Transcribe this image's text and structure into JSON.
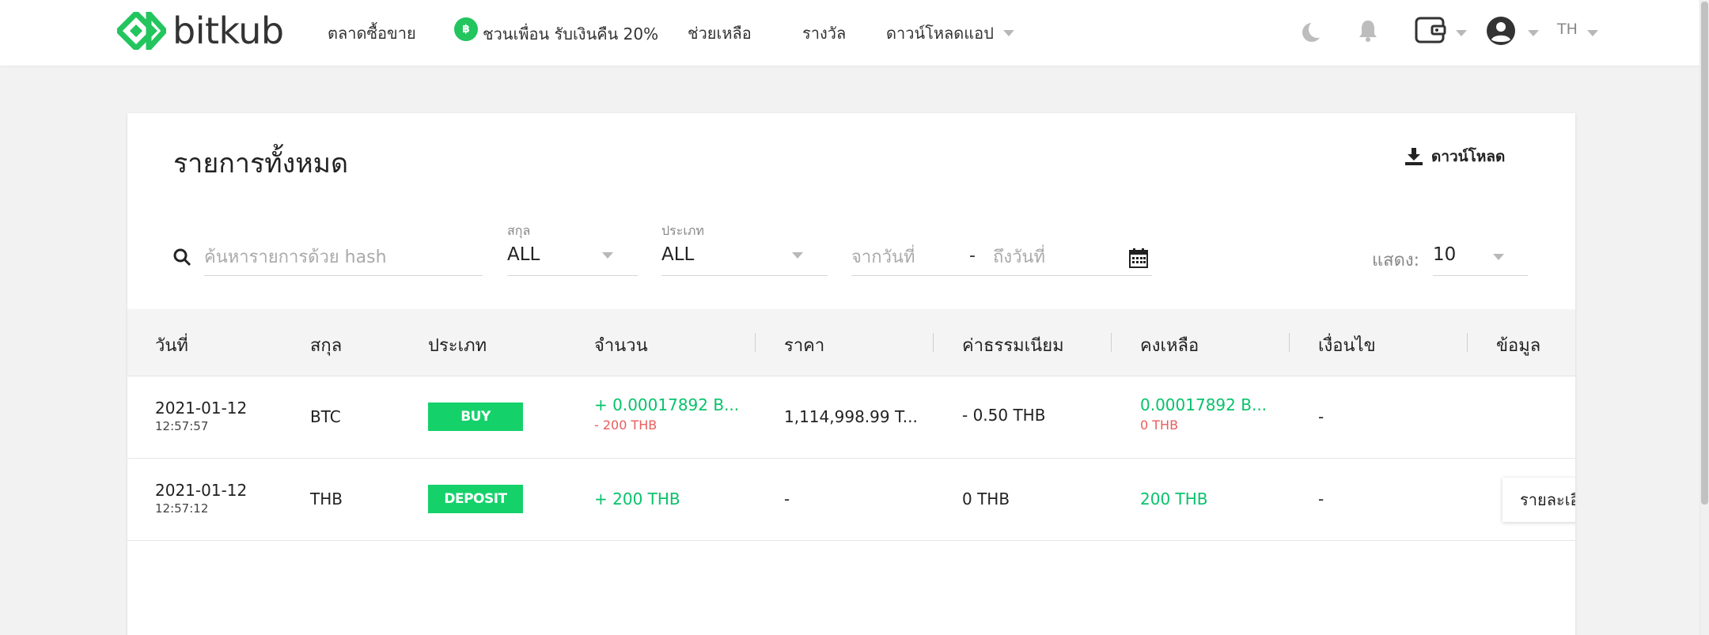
{
  "header": {
    "logo_text": "bitkub",
    "nav": {
      "market": "ตลาดซื้อขาย",
      "coin_glyph": "฿",
      "referral": "ชวนเพื่อน รับเงินคืน 20%",
      "help": "ช่วยเหลือ",
      "rewards": "รางวัล",
      "download_app": "ดาวน์โหลดแอป"
    },
    "icons": [
      "moon-icon",
      "bell-icon",
      "wallet-icon",
      "account-icon"
    ],
    "language": "TH"
  },
  "page": {
    "title": "รายการทั้งหมด",
    "download_label": "ดาวน์โหลด"
  },
  "filters": {
    "search_placeholder": "ค้นหารายการด้วย hash",
    "currency_label": "สกุล",
    "currency_value": "ALL",
    "type_label": "ประเภท",
    "type_value": "ALL",
    "from_placeholder": "จากวันที่",
    "date_separator": "-",
    "to_placeholder": "ถึงวันที่",
    "show_label": "แสดง:",
    "show_value": "10"
  },
  "table": {
    "columns": [
      "วันที่",
      "สกุล",
      "ประเภท",
      "จำนวน",
      "ราคา",
      "ค่าธรรมเนียม",
      "คงเหลือ",
      "เงื่อนไข",
      "ข้อมูล"
    ],
    "rows": [
      {
        "date": "2021-01-12",
        "time": "12:57:57",
        "currency": "BTC",
        "type": "BUY",
        "amount": "+ 0.00017892 B...",
        "amount_sub": "- 200 THB",
        "price": "1,114,998.99 T...",
        "fee": "- 0.50 THB",
        "balance": "0.00017892 B...",
        "balance_sub": "0 THB",
        "condition": "-"
      },
      {
        "date": "2021-01-12",
        "time": "12:57:12",
        "currency": "THB",
        "type": "DEPOSIT",
        "amount": "+ 200 THB",
        "price": "-",
        "fee": "0 THB",
        "balance": "200 THB",
        "condition": "-",
        "details_label": "รายละเอียด"
      }
    ]
  },
  "colors": {
    "brand_green": "#22c55e",
    "positive": "#08c26b",
    "negative": "#e85d5d",
    "badge": "#15d16a"
  }
}
